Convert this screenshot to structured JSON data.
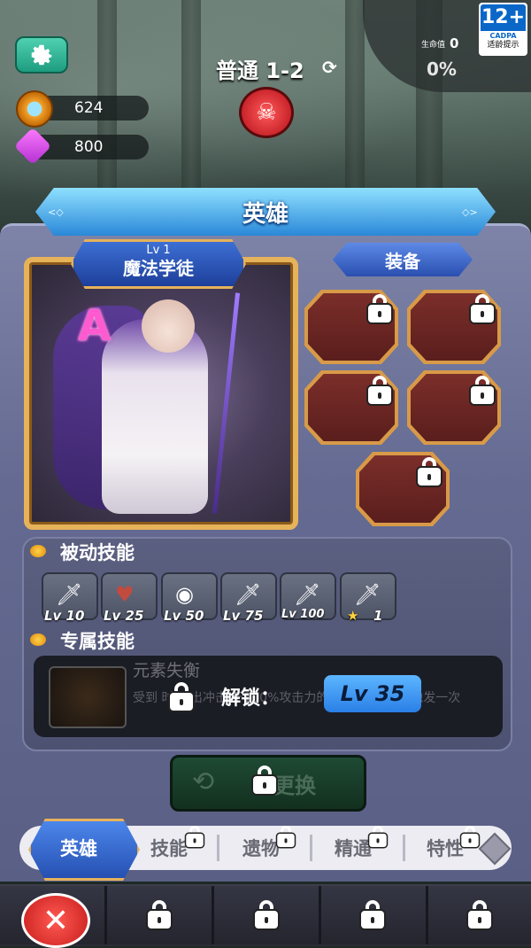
{
  "hud": {
    "stage_label": "普通 1-2",
    "coins": "624",
    "gems": "800",
    "hp_label": "生命值",
    "hp_value": "0",
    "hp_percent": "0%",
    "age_rating": "12+",
    "age_org": "CADPA",
    "age_hint": "适龄提示"
  },
  "title": "英雄",
  "hero": {
    "level": "Lv 1",
    "name": "魔法学徒",
    "rank": "A"
  },
  "equipment": {
    "title": "装备",
    "slot_count": 5
  },
  "passive_skills": {
    "title": "被动技能",
    "items": [
      {
        "icon": "sword-icon",
        "label": "Lv 10"
      },
      {
        "icon": "heart-icon",
        "label": "Lv 25"
      },
      {
        "icon": "orb-icon",
        "label": "Lv 50"
      },
      {
        "icon": "sword-icon",
        "label": "Lv 75"
      },
      {
        "icon": "sword-icon",
        "label": "Lv 100"
      },
      {
        "icon": "sword-icon",
        "label": "1"
      }
    ]
  },
  "exclusive_skill": {
    "title": "专属技能",
    "name": "元素失衡",
    "description": "受到 时间 出冲击 于100%攻击力的伤害，每2秒只触发一次",
    "unlock_label": "解锁：",
    "unlock_level": "Lv 35"
  },
  "swap_button": "更换",
  "tabs": [
    "英雄",
    "技能",
    "遗物",
    "精通",
    "特性"
  ],
  "colors": {
    "accent": "#2a88d8",
    "gold": "#e6b25a",
    "panel": "#646a91"
  }
}
